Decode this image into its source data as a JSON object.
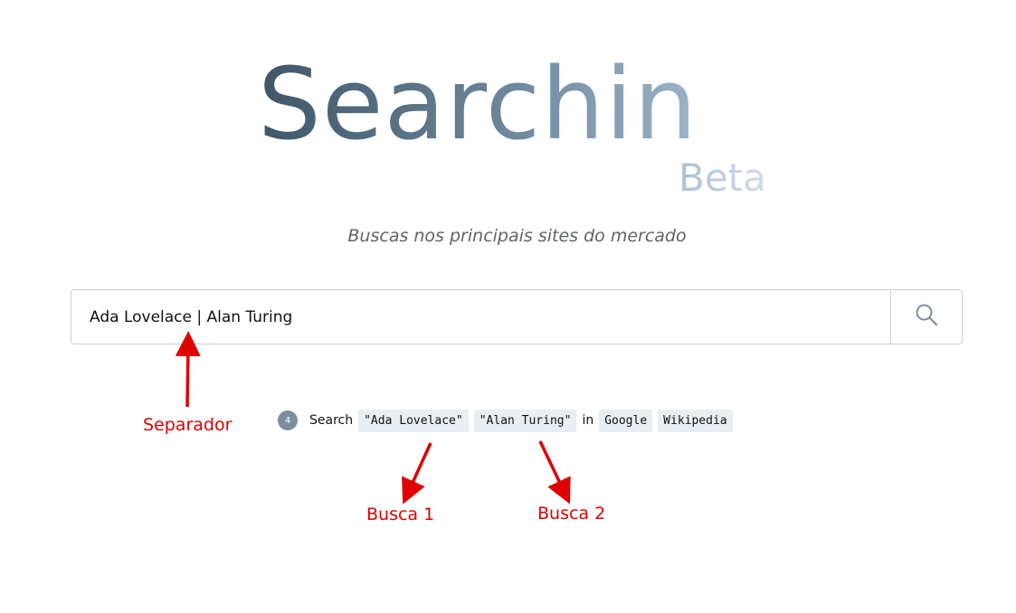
{
  "logo": {
    "title": "Searchin",
    "badge": "Beta"
  },
  "tagline": "Buscas nos principais sites do mercado",
  "search": {
    "value": "Ada Lovelace | Alan Turing",
    "button_icon": "search-icon"
  },
  "summary": {
    "count": "4",
    "search_word": "Search",
    "terms": [
      "\"Ada Lovelace\"",
      "\"Alan Turing\""
    ],
    "in_word": "in",
    "sites": [
      "Google",
      "Wikipedia"
    ]
  },
  "annotations": {
    "separator": "Separador",
    "busca1": "Busca 1",
    "busca2": "Busca 2",
    "color": "#e00000"
  },
  "colors": {
    "logo_dark": "#3f5667",
    "logo_light": "#9cb4ca",
    "badge_bg": "#7a8ea0",
    "code_bg": "#e9eef3"
  }
}
